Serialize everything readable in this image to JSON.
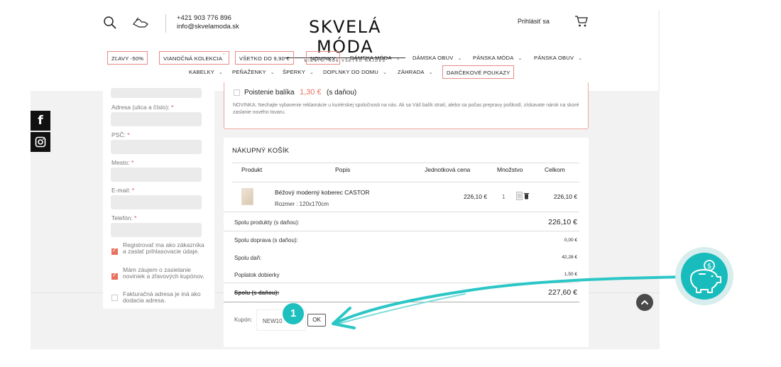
{
  "header": {
    "phone": "+421 903 776 896",
    "email": "info@skvelamoda.sk",
    "logo_title": "SKVELÁ MÓDA",
    "logo_tagline": "MIESTO, KDE VŠETKO NÁJDEŠ",
    "login": "Prihlásiť sa"
  },
  "nav": {
    "row1": [
      "ZĽAVY -50%",
      "VIANOČNÁ KOLEKCIA",
      "VŠETKO DO 9,90 €",
      "NOVINKY",
      "DÁMSKA MÓDA",
      "DÁMSKA OBUV",
      "PÁNSKA MÓDA",
      "PÁNSKA OBUV"
    ],
    "row2": [
      "KABELKY",
      "PEŇAŽENKY",
      "ŠPERKY",
      "DOPLNKY DO DOMU",
      "ZÁHRADA",
      "DARČEKOVÉ POUKAZY"
    ]
  },
  "form": {
    "address_label": "Adresa (ulica a číslo):",
    "psc_label": "PSČ:",
    "city_label": "Mesto:",
    "email_label": "E-mail:",
    "phone_label": "Telefón:",
    "required_mark": "*",
    "checkbox_register": "Registrovať ma ako zákazníka a zaslať prihlasovacie údaje.",
    "checkbox_newsletter": "Mám záujem o zasielanie noviniek a zľavových kupónov.",
    "checkbox_billing": "Fakturačná adresa je iná ako dodacia adresa."
  },
  "insurance": {
    "label": "Poistenie balíka",
    "price": "1,30 €",
    "price_note": "(s daňou)",
    "note": "NOVINKA: Nechajte vybavenie reklamácie u kuriérskej spoločnosti na nás. Ak sa Váš balík stratí, alebo sa počas prepravy poškodí, získavate nárok na skoré zaslanie nového tovaru."
  },
  "cart": {
    "title": "NÁKUPNÝ KOŠÍK",
    "columns": [
      "Produkt",
      "Popis",
      "Jednotková cena",
      "Množstvo",
      "Celkom"
    ],
    "item": {
      "name": "Béžový moderný koberec CASTOR",
      "size": "Rozmer : 120x170cm",
      "unit_price": "226,10 €",
      "qty": "1",
      "total": "226,10 €"
    },
    "summary": [
      {
        "label": "Spolu produkty (s daňou):",
        "value": "226,10 €"
      },
      {
        "label": "Spolu doprava (s daňou):",
        "value": "0,00 €"
      },
      {
        "label": "Spolu daň:",
        "value": "42,28 €"
      },
      {
        "label": "Poplatok dobierky",
        "value": "1,50 €"
      },
      {
        "label": "Spolu (s daňou):",
        "value": "227,60 €"
      }
    ],
    "coupon_label": "Kupón:",
    "coupon_value": "NEW10",
    "ok_label": "OK"
  },
  "overlay": {
    "step_number": "1",
    "accent": "#1dbfbf"
  }
}
